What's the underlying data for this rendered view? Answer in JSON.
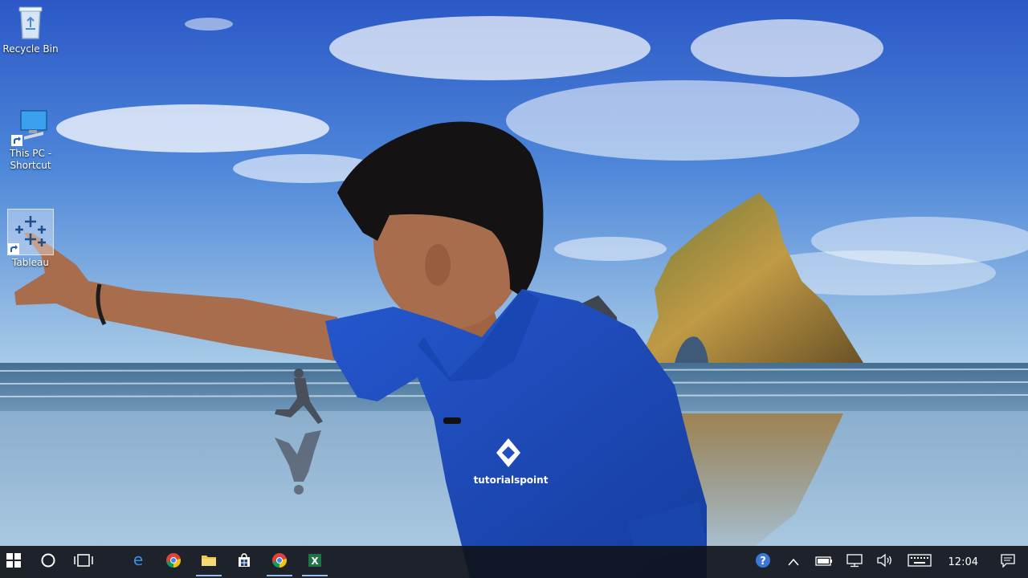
{
  "desktop": {
    "icons": [
      {
        "label": "Recycle Bin",
        "icon": "recycle-bin-icon"
      },
      {
        "label": "This PC -\nShortcut",
        "icon": "this-pc-icon"
      },
      {
        "label": "Tableau",
        "icon": "tableau-icon"
      }
    ],
    "presenter_shirt_logo": "tutorialspoint"
  },
  "taskbar": {
    "buttons": [
      {
        "name": "start",
        "icon": "windows-logo-icon"
      },
      {
        "name": "cortana",
        "icon": "cortana-circle-icon"
      },
      {
        "name": "task-view",
        "icon": "task-view-icon"
      },
      {
        "name": "edge",
        "icon": "edge-icon"
      },
      {
        "name": "chrome",
        "icon": "chrome-icon"
      },
      {
        "name": "file-explorer",
        "icon": "folder-icon",
        "running": true
      },
      {
        "name": "store",
        "icon": "store-icon"
      },
      {
        "name": "chrome-2",
        "icon": "chrome-icon",
        "running": true
      },
      {
        "name": "excel",
        "icon": "excel-icon",
        "running": true
      }
    ],
    "tray": {
      "help_icon": "help-icon",
      "chevron_icon": "chevron-up-icon",
      "battery_icon": "battery-icon",
      "network_icon": "network-icon",
      "volume_icon": "volume-icon",
      "keyboard_icon": "keyboard-icon",
      "time": "12:04",
      "notifications_icon": "action-center-icon"
    }
  },
  "colors": {
    "sky_top": "#2f5fcb",
    "sky_bottom": "#a9cbe8",
    "sea": "#3d6f95",
    "sand": "#8fb1cf",
    "shirt": "#1f4fc1",
    "rock": "#b38a3c",
    "taskbar": "#10141e",
    "chrome_red": "#db4437",
    "chrome_yellow": "#f4c20d",
    "chrome_green": "#0f9d58",
    "chrome_blue": "#4285f4",
    "edge_blue": "#3277dc",
    "folder": "#f2c94c",
    "excel": "#217346"
  }
}
